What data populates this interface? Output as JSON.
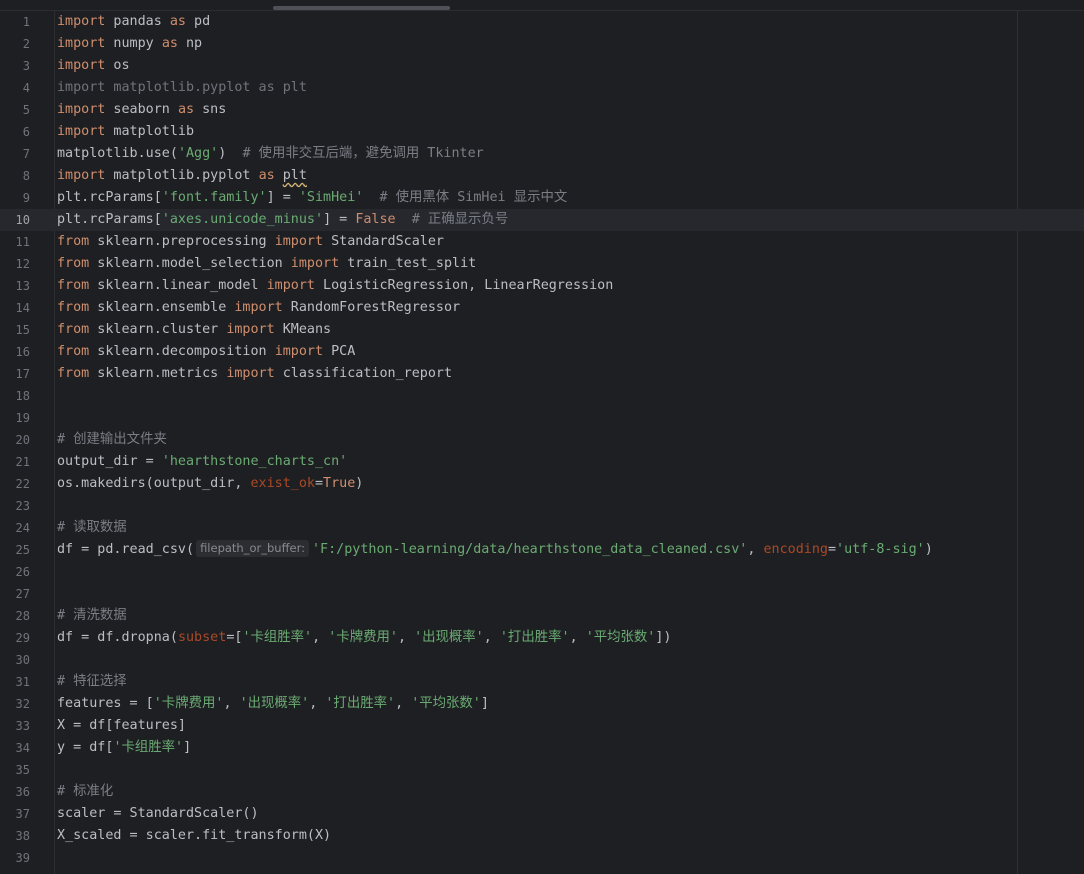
{
  "editor": {
    "current_line": 10,
    "lines": [
      {
        "n": "1",
        "tokens": [
          {
            "t": "import",
            "c": "kw"
          },
          {
            "t": " pandas ",
            "c": ""
          },
          {
            "t": "as",
            "c": "kw"
          },
          {
            "t": " pd",
            "c": ""
          }
        ]
      },
      {
        "n": "2",
        "tokens": [
          {
            "t": "import",
            "c": "kw"
          },
          {
            "t": " numpy ",
            "c": ""
          },
          {
            "t": "as",
            "c": "kw"
          },
          {
            "t": " np",
            "c": ""
          }
        ]
      },
      {
        "n": "3",
        "tokens": [
          {
            "t": "import",
            "c": "kw"
          },
          {
            "t": " os",
            "c": ""
          }
        ]
      },
      {
        "n": "4",
        "tokens": [
          {
            "t": "import matplotlib.pyplot as plt",
            "c": "dim"
          }
        ]
      },
      {
        "n": "5",
        "tokens": [
          {
            "t": "import",
            "c": "kw"
          },
          {
            "t": " seaborn ",
            "c": ""
          },
          {
            "t": "as",
            "c": "kw"
          },
          {
            "t": " sns",
            "c": ""
          }
        ]
      },
      {
        "n": "6",
        "tokens": [
          {
            "t": "import",
            "c": "kw"
          },
          {
            "t": " matplotlib",
            "c": ""
          }
        ]
      },
      {
        "n": "7",
        "tokens": [
          {
            "t": "matplotlib.use(",
            "c": ""
          },
          {
            "t": "'Agg'",
            "c": "str"
          },
          {
            "t": ")  ",
            "c": ""
          },
          {
            "t": "# 使用非交互后端，避免调用 Tkinter",
            "c": "cm"
          }
        ]
      },
      {
        "n": "8",
        "tokens": [
          {
            "t": "import",
            "c": "kw"
          },
          {
            "t": " matplotlib.pyplot ",
            "c": ""
          },
          {
            "t": "as",
            "c": "kw"
          },
          {
            "t": " ",
            "c": ""
          },
          {
            "t": "plt",
            "c": "squiggle"
          }
        ]
      },
      {
        "n": "9",
        "tokens": [
          {
            "t": "plt.rcParams[",
            "c": ""
          },
          {
            "t": "'font.family'",
            "c": "str"
          },
          {
            "t": "] = ",
            "c": ""
          },
          {
            "t": "'SimHei'",
            "c": "str"
          },
          {
            "t": "  ",
            "c": ""
          },
          {
            "t": "# 使用黑体 SimHei 显示中文",
            "c": "cm"
          }
        ]
      },
      {
        "n": "10",
        "tokens": [
          {
            "t": "plt.rcParams[",
            "c": ""
          },
          {
            "t": "'axes.unicode_minus'",
            "c": "str"
          },
          {
            "t": "] = ",
            "c": ""
          },
          {
            "t": "False",
            "c": "const"
          },
          {
            "t": "  ",
            "c": ""
          },
          {
            "t": "# 正确显示负号",
            "c": "cm"
          }
        ]
      },
      {
        "n": "11",
        "tokens": [
          {
            "t": "from",
            "c": "kw"
          },
          {
            "t": " sklearn.preprocessing ",
            "c": ""
          },
          {
            "t": "import",
            "c": "kw"
          },
          {
            "t": " StandardScaler",
            "c": ""
          }
        ]
      },
      {
        "n": "12",
        "tokens": [
          {
            "t": "from",
            "c": "kw"
          },
          {
            "t": " sklearn.model_selection ",
            "c": ""
          },
          {
            "t": "import",
            "c": "kw"
          },
          {
            "t": " train_test_split",
            "c": ""
          }
        ]
      },
      {
        "n": "13",
        "tokens": [
          {
            "t": "from",
            "c": "kw"
          },
          {
            "t": " sklearn.linear_model ",
            "c": ""
          },
          {
            "t": "import",
            "c": "kw"
          },
          {
            "t": " LogisticRegression, LinearRegression",
            "c": ""
          }
        ]
      },
      {
        "n": "14",
        "tokens": [
          {
            "t": "from",
            "c": "kw"
          },
          {
            "t": " sklearn.ensemble ",
            "c": ""
          },
          {
            "t": "import",
            "c": "kw"
          },
          {
            "t": " RandomForestRegressor",
            "c": ""
          }
        ]
      },
      {
        "n": "15",
        "tokens": [
          {
            "t": "from",
            "c": "kw"
          },
          {
            "t": " sklearn.cluster ",
            "c": ""
          },
          {
            "t": "import",
            "c": "kw"
          },
          {
            "t": " KMeans",
            "c": ""
          }
        ]
      },
      {
        "n": "16",
        "tokens": [
          {
            "t": "from",
            "c": "kw"
          },
          {
            "t": " sklearn.decomposition ",
            "c": ""
          },
          {
            "t": "import",
            "c": "kw"
          },
          {
            "t": " PCA",
            "c": ""
          }
        ]
      },
      {
        "n": "17",
        "tokens": [
          {
            "t": "from",
            "c": "kw"
          },
          {
            "t": " sklearn.metrics ",
            "c": ""
          },
          {
            "t": "import",
            "c": "kw"
          },
          {
            "t": " classification_report",
            "c": ""
          }
        ]
      },
      {
        "n": "18",
        "tokens": []
      },
      {
        "n": "19",
        "tokens": []
      },
      {
        "n": "20",
        "tokens": [
          {
            "t": "# 创建输出文件夹",
            "c": "cm"
          }
        ]
      },
      {
        "n": "21",
        "tokens": [
          {
            "t": "output_dir = ",
            "c": ""
          },
          {
            "t": "'hearthstone_charts_cn'",
            "c": "str"
          }
        ]
      },
      {
        "n": "22",
        "tokens": [
          {
            "t": "os.makedirs(output_dir, ",
            "c": ""
          },
          {
            "t": "exist_ok",
            "c": "named"
          },
          {
            "t": "=",
            "c": ""
          },
          {
            "t": "True",
            "c": "const"
          },
          {
            "t": ")",
            "c": ""
          }
        ]
      },
      {
        "n": "23",
        "tokens": []
      },
      {
        "n": "24",
        "tokens": [
          {
            "t": "# 读取数据",
            "c": "cm"
          }
        ]
      },
      {
        "n": "25",
        "tokens": [
          {
            "t": "df = pd.read_csv(",
            "c": ""
          },
          {
            "t": "filepath_or_buffer:",
            "c": "hint"
          },
          {
            "t": "'F:/python-learning/data/hearthstone_data_cleaned.csv'",
            "c": "str"
          },
          {
            "t": ", ",
            "c": ""
          },
          {
            "t": "encoding",
            "c": "named"
          },
          {
            "t": "=",
            "c": ""
          },
          {
            "t": "'utf-8-sig'",
            "c": "str"
          },
          {
            "t": ")",
            "c": ""
          }
        ]
      },
      {
        "n": "26",
        "tokens": []
      },
      {
        "n": "27",
        "tokens": []
      },
      {
        "n": "28",
        "tokens": [
          {
            "t": "# 清洗数据",
            "c": "cm"
          }
        ]
      },
      {
        "n": "29",
        "tokens": [
          {
            "t": "df = df.dropna(",
            "c": ""
          },
          {
            "t": "subset",
            "c": "named"
          },
          {
            "t": "=[",
            "c": ""
          },
          {
            "t": "'卡组胜率'",
            "c": "str"
          },
          {
            "t": ", ",
            "c": ""
          },
          {
            "t": "'卡牌费用'",
            "c": "str"
          },
          {
            "t": ", ",
            "c": ""
          },
          {
            "t": "'出现概率'",
            "c": "str"
          },
          {
            "t": ", ",
            "c": ""
          },
          {
            "t": "'打出胜率'",
            "c": "str"
          },
          {
            "t": ", ",
            "c": ""
          },
          {
            "t": "'平均张数'",
            "c": "str"
          },
          {
            "t": "])",
            "c": ""
          }
        ]
      },
      {
        "n": "30",
        "tokens": []
      },
      {
        "n": "31",
        "tokens": [
          {
            "t": "# 特征选择",
            "c": "cm"
          }
        ]
      },
      {
        "n": "32",
        "tokens": [
          {
            "t": "features = [",
            "c": ""
          },
          {
            "t": "'卡牌费用'",
            "c": "str"
          },
          {
            "t": ", ",
            "c": ""
          },
          {
            "t": "'出现概率'",
            "c": "str"
          },
          {
            "t": ", ",
            "c": ""
          },
          {
            "t": "'打出胜率'",
            "c": "str"
          },
          {
            "t": ", ",
            "c": ""
          },
          {
            "t": "'平均张数'",
            "c": "str"
          },
          {
            "t": "]",
            "c": ""
          }
        ]
      },
      {
        "n": "33",
        "tokens": [
          {
            "t": "X = df[features]",
            "c": ""
          }
        ]
      },
      {
        "n": "34",
        "tokens": [
          {
            "t": "y = df[",
            "c": ""
          },
          {
            "t": "'卡组胜率'",
            "c": "str"
          },
          {
            "t": "]",
            "c": ""
          }
        ]
      },
      {
        "n": "35",
        "tokens": []
      },
      {
        "n": "36",
        "tokens": [
          {
            "t": "# 标准化",
            "c": "cm"
          }
        ]
      },
      {
        "n": "37",
        "tokens": [
          {
            "t": "scaler = StandardScaler()",
            "c": ""
          }
        ]
      },
      {
        "n": "38",
        "tokens": [
          {
            "t": "X_scaled = scaler.fit_transform(X)",
            "c": ""
          }
        ]
      },
      {
        "n": "39",
        "tokens": []
      }
    ]
  }
}
